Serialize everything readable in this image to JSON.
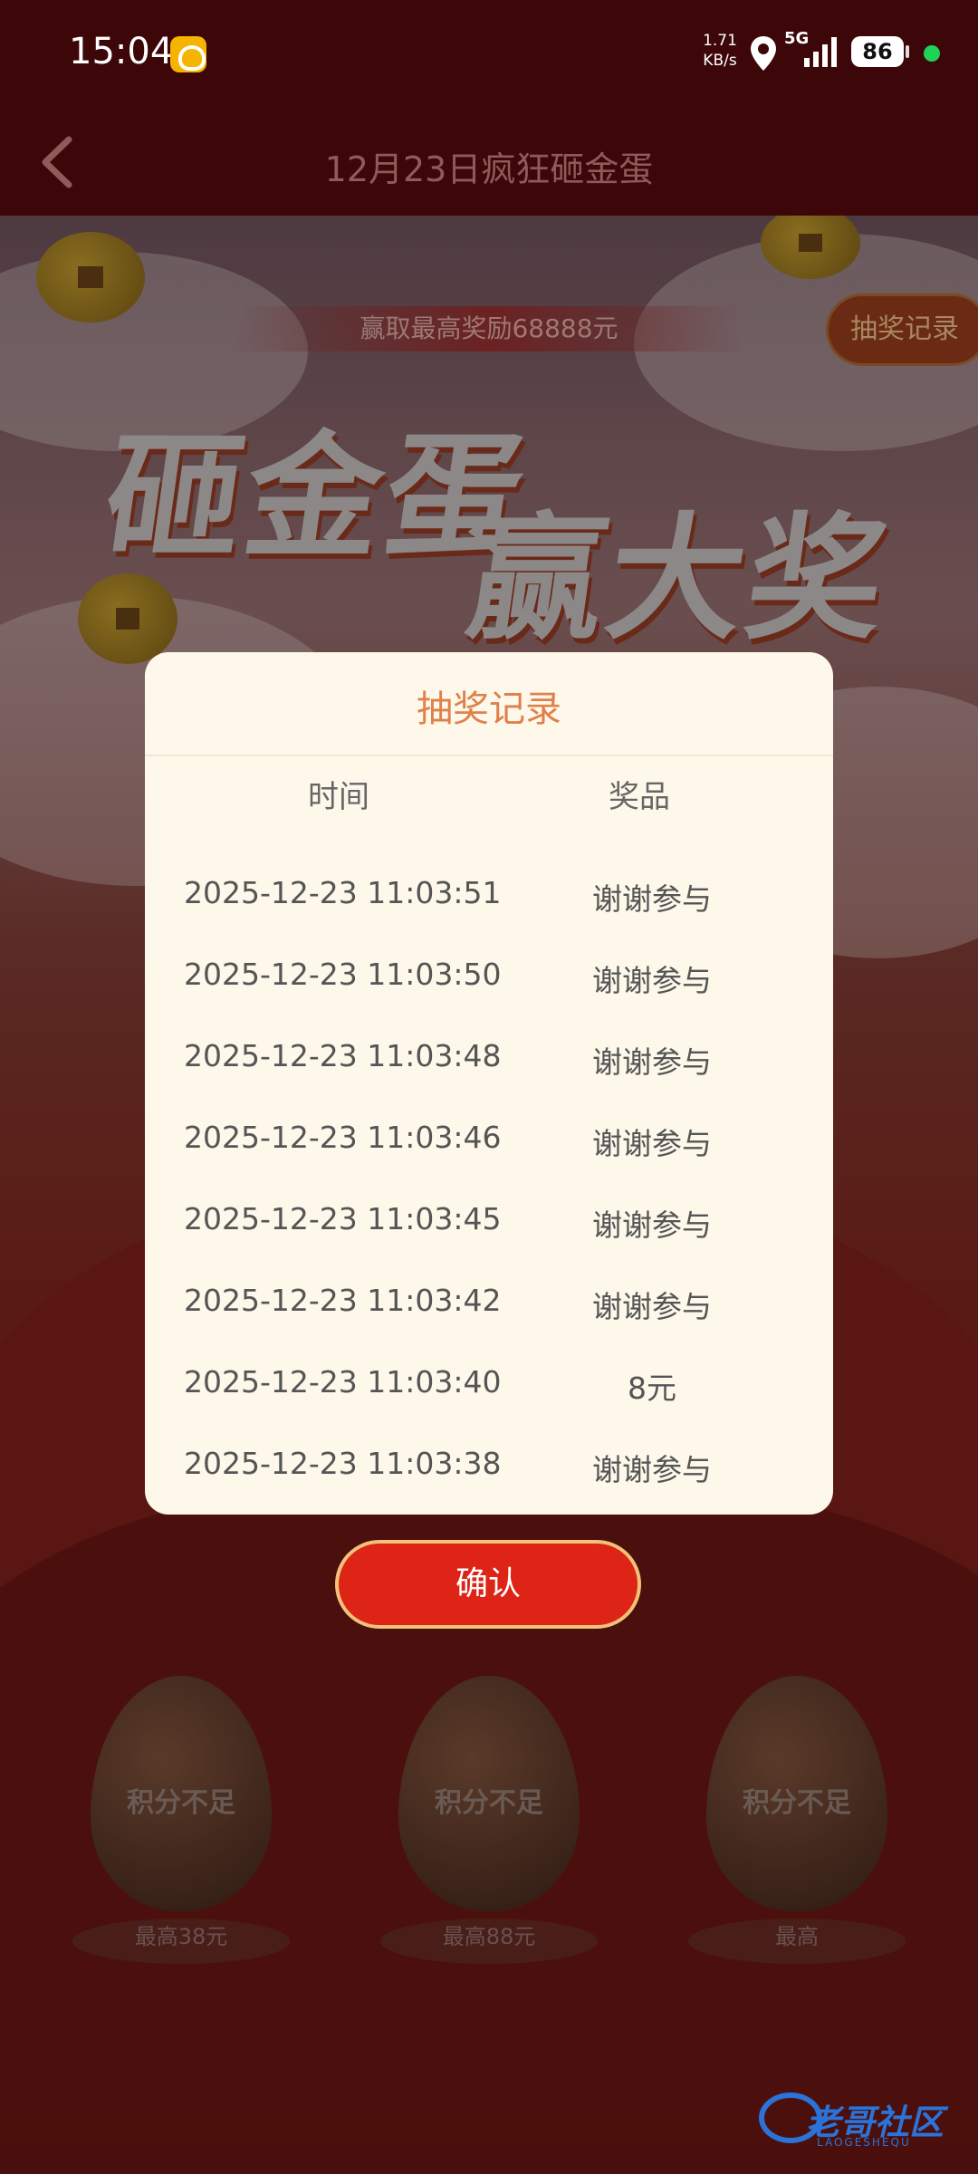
{
  "status_bar": {
    "time": "15:04",
    "net_speed_value": "1.71",
    "net_speed_unit": "KB/s",
    "network": "5G",
    "battery": "86"
  },
  "header": {
    "title": "12月23日疯狂砸金蛋"
  },
  "banner": {
    "slogan": "赢取最高奖励68888元",
    "record_button": "抽奖记录",
    "headline_left": "砸金蛋",
    "headline_right": "赢大奖"
  },
  "eggs": [
    {
      "status": "积分不足",
      "max_prize": "最高38元"
    },
    {
      "status": "积分不足",
      "max_prize": "最高88元"
    },
    {
      "status": "积分不足",
      "max_prize": "最高"
    }
  ],
  "modal": {
    "title": "抽奖记录",
    "columns": {
      "time": "时间",
      "prize": "奖品"
    },
    "records": [
      {
        "time": "2025-12-23 11:03:51",
        "prize": "谢谢参与"
      },
      {
        "time": "2025-12-23 11:03:50",
        "prize": "谢谢参与"
      },
      {
        "time": "2025-12-23 11:03:48",
        "prize": "谢谢参与"
      },
      {
        "time": "2025-12-23 11:03:46",
        "prize": "谢谢参与"
      },
      {
        "time": "2025-12-23 11:03:45",
        "prize": "谢谢参与"
      },
      {
        "time": "2025-12-23 11:03:42",
        "prize": "谢谢参与"
      },
      {
        "time": "2025-12-23 11:03:40",
        "prize": "8元"
      },
      {
        "time": "2025-12-23 11:03:38",
        "prize": "谢谢参与"
      }
    ],
    "confirm_button": "确认"
  },
  "watermark": {
    "text": "老哥社区",
    "sub": "LAOGESHEQU"
  },
  "colors": {
    "accent_red": "#dd2416",
    "modal_title": "#e0804a",
    "modal_bg": "#fdf8ea"
  }
}
